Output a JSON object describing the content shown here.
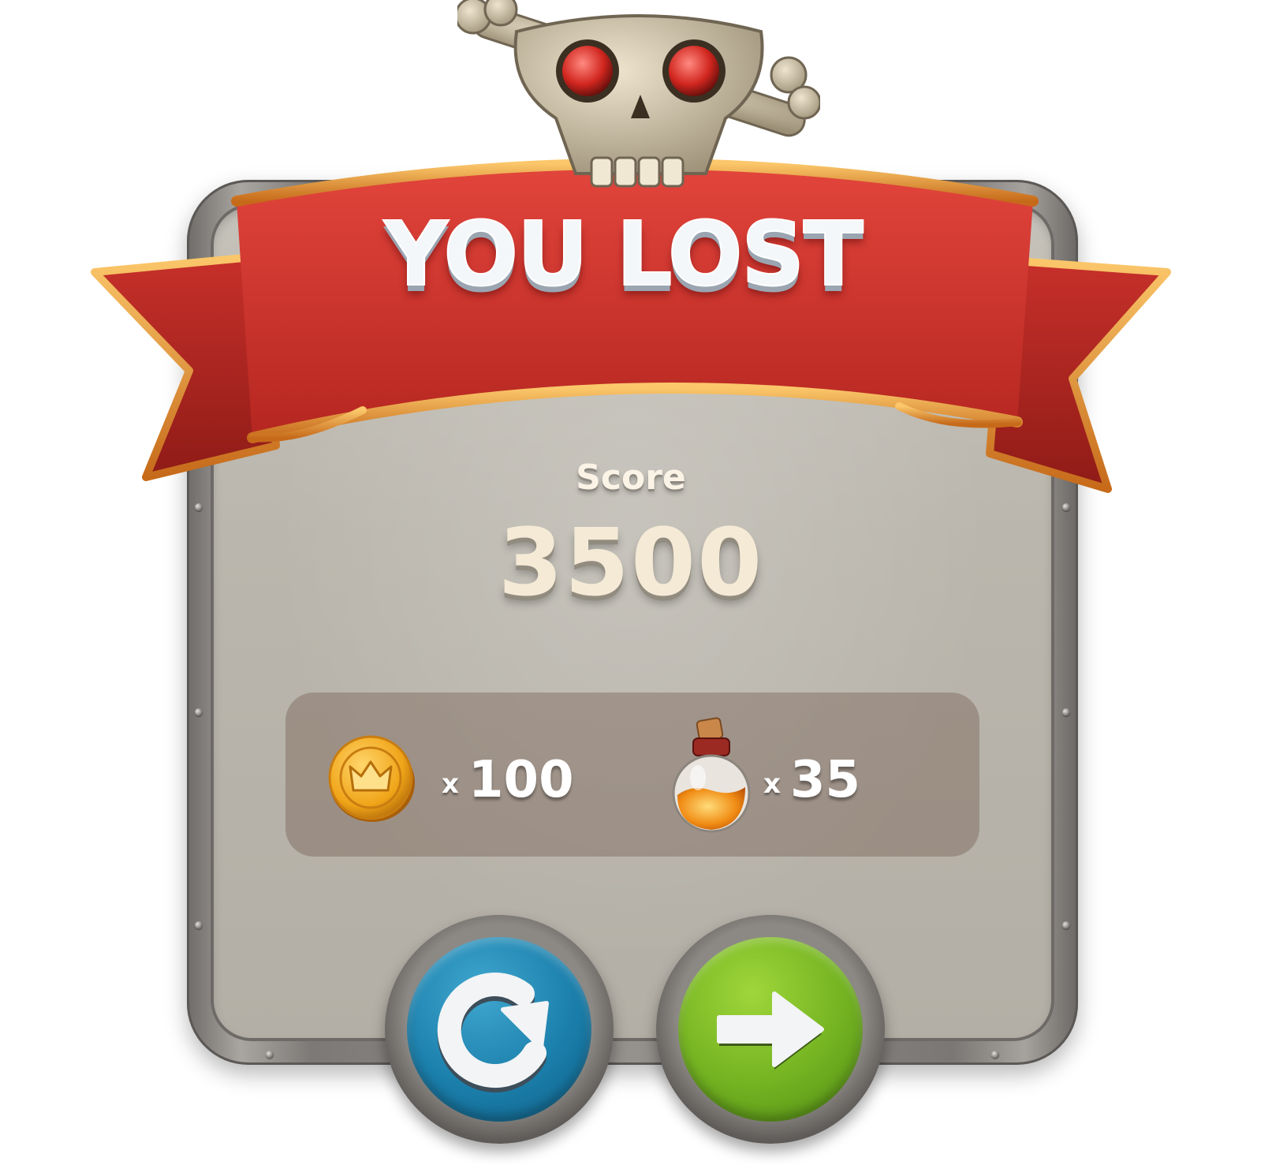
{
  "dialog": {
    "title": "YOU LOST",
    "score_label": "Score",
    "score_value": "3500"
  },
  "rewards": [
    {
      "icon": "crown-coin-icon",
      "prefix": "x",
      "count": "100"
    },
    {
      "icon": "potion-bottle-icon",
      "prefix": "x",
      "count": "35"
    }
  ],
  "buttons": {
    "retry": {
      "icon": "retry-arrow-icon"
    },
    "next": {
      "icon": "right-arrow-icon"
    }
  },
  "colors": {
    "ribbon": "#d8352f",
    "ribbon_trim": "#e89a3a",
    "retry_button": "#1b7fab",
    "next_button": "#73b221",
    "panel": "#bab6ad"
  }
}
